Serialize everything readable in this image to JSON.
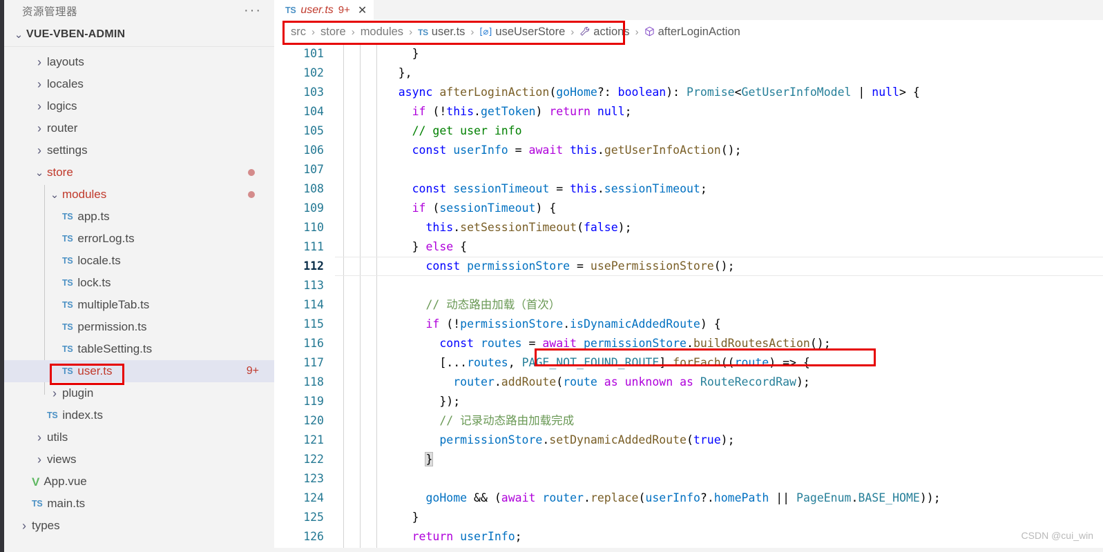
{
  "sidebar": {
    "panel_title": "资源管理器",
    "more_actions_icon": "ellipsis-icon",
    "root_folder": "VUE-VBEN-ADMIN",
    "items": [
      {
        "label": "layouts",
        "type": "folder",
        "expanded": false,
        "depth": 1,
        "icon": "chevron-right-icon"
      },
      {
        "label": "locales",
        "type": "folder",
        "expanded": false,
        "depth": 1,
        "icon": "chevron-right-icon"
      },
      {
        "label": "logics",
        "type": "folder",
        "expanded": false,
        "depth": 1,
        "icon": "chevron-right-icon"
      },
      {
        "label": "router",
        "type": "folder",
        "expanded": false,
        "depth": 1,
        "icon": "chevron-right-icon"
      },
      {
        "label": "settings",
        "type": "folder",
        "expanded": false,
        "depth": 1,
        "icon": "chevron-right-icon"
      },
      {
        "label": "store",
        "type": "folder",
        "expanded": true,
        "depth": 1,
        "icon": "chevron-down-icon",
        "modified": true,
        "color": "#c0392b"
      },
      {
        "label": "modules",
        "type": "folder",
        "expanded": true,
        "depth": 2,
        "icon": "chevron-down-icon",
        "modified": true,
        "color": "#c0392b"
      },
      {
        "label": "app.ts",
        "type": "file",
        "depth": 3,
        "icon": "ts-file-icon"
      },
      {
        "label": "errorLog.ts",
        "type": "file",
        "depth": 3,
        "icon": "ts-file-icon"
      },
      {
        "label": "locale.ts",
        "type": "file",
        "depth": 3,
        "icon": "ts-file-icon"
      },
      {
        "label": "lock.ts",
        "type": "file",
        "depth": 3,
        "icon": "ts-file-icon"
      },
      {
        "label": "multipleTab.ts",
        "type": "file",
        "depth": 3,
        "icon": "ts-file-icon"
      },
      {
        "label": "permission.ts",
        "type": "file",
        "depth": 3,
        "icon": "ts-file-icon"
      },
      {
        "label": "tableSetting.ts",
        "type": "file",
        "depth": 3,
        "icon": "ts-file-icon"
      },
      {
        "label": "user.ts",
        "type": "file",
        "depth": 3,
        "icon": "ts-file-icon",
        "selected": true,
        "badge": "9+",
        "color": "#c0392b",
        "annotated": true
      },
      {
        "label": "plugin",
        "type": "folder",
        "expanded": false,
        "depth": 2,
        "icon": "chevron-right-icon"
      },
      {
        "label": "index.ts",
        "type": "file",
        "depth": 2,
        "icon": "ts-file-icon"
      },
      {
        "label": "utils",
        "type": "folder",
        "expanded": false,
        "depth": 1,
        "icon": "chevron-right-icon"
      },
      {
        "label": "views",
        "type": "folder",
        "expanded": false,
        "depth": 1,
        "icon": "chevron-right-icon"
      },
      {
        "label": "App.vue",
        "type": "file",
        "depth": 1,
        "icon": "vue-file-icon"
      },
      {
        "label": "main.ts",
        "type": "file",
        "depth": 1,
        "icon": "ts-file-icon"
      },
      {
        "label": "types",
        "type": "folder",
        "expanded": false,
        "depth": 0,
        "icon": "chevron-right-icon"
      }
    ]
  },
  "editor": {
    "tab": {
      "icon": "ts-file-icon",
      "name": "user.ts",
      "badge": "9+",
      "close_icon": "close-icon",
      "dirty": true
    },
    "breadcrumb": {
      "annotated": true,
      "items": [
        {
          "label": "src",
          "icon": ""
        },
        {
          "label": "store",
          "icon": ""
        },
        {
          "label": "modules",
          "icon": ""
        },
        {
          "label": "user.ts",
          "icon": "ts-file-icon"
        },
        {
          "label": "useUserStore",
          "icon": "interface-icon"
        },
        {
          "label": "actions",
          "icon": "property-wrench-icon"
        },
        {
          "label": "afterLoginAction",
          "icon": "method-cube-icon"
        }
      ],
      "separator": "›"
    },
    "current_line": 112,
    "first_line": 101,
    "last_line": 126,
    "annotations": [
      {
        "name": "breadcrumb-highlight",
        "color": "#e60000"
      },
      {
        "name": "sidebar-file-highlight",
        "color": "#e60000"
      },
      {
        "name": "await-buildroutesaction-highlight",
        "color": "#e60000"
      }
    ],
    "lines": [
      {
        "n": 101,
        "text": "      }"
      },
      {
        "n": 102,
        "text": "    },"
      },
      {
        "n": 103,
        "text": "    async afterLoginAction(goHome?: boolean): Promise<GetUserInfoModel | null> {"
      },
      {
        "n": 104,
        "text": "      if (!this.getToken) return null;"
      },
      {
        "n": 105,
        "text": "      // get user info"
      },
      {
        "n": 106,
        "text": "      const userInfo = await this.getUserInfoAction();"
      },
      {
        "n": 107,
        "text": ""
      },
      {
        "n": 108,
        "text": "      const sessionTimeout = this.sessionTimeout;"
      },
      {
        "n": 109,
        "text": "      if (sessionTimeout) {"
      },
      {
        "n": 110,
        "text": "        this.setSessionTimeout(false);"
      },
      {
        "n": 111,
        "text": "      } else {"
      },
      {
        "n": 112,
        "text": "        const permissionStore = usePermissionStore();"
      },
      {
        "n": 113,
        "text": ""
      },
      {
        "n": 114,
        "text": "        // 动态路由加载（首次）"
      },
      {
        "n": 115,
        "text": "        if (!permissionStore.isDynamicAddedRoute) {"
      },
      {
        "n": 116,
        "text": "          const routes = await permissionStore.buildRoutesAction();"
      },
      {
        "n": 117,
        "text": "          [...routes, PAGE_NOT_FOUND_ROUTE].forEach((route) => {"
      },
      {
        "n": 118,
        "text": "            router.addRoute(route as unknown as RouteRecordRaw);"
      },
      {
        "n": 119,
        "text": "          });"
      },
      {
        "n": 120,
        "text": "          // 记录动态路由加载完成"
      },
      {
        "n": 121,
        "text": "          permissionStore.setDynamicAddedRoute(true);"
      },
      {
        "n": 122,
        "text": "        }"
      },
      {
        "n": 123,
        "text": ""
      },
      {
        "n": 124,
        "text": "        goHome && (await router.replace(userInfo?.homePath || PageEnum.BASE_HOME));"
      },
      {
        "n": 125,
        "text": "      }"
      },
      {
        "n": 126,
        "text": "      return userInfo;"
      }
    ]
  },
  "watermark": "CSDN @cui_win",
  "colors": {
    "accent_red": "#e60000",
    "ts_blue": "#4a90c4",
    "linenum": "#237893",
    "selection_bg": "#e2e4f0",
    "sidebar_bg": "#f3f3f3",
    "modified_dot": "#d48b8b"
  }
}
